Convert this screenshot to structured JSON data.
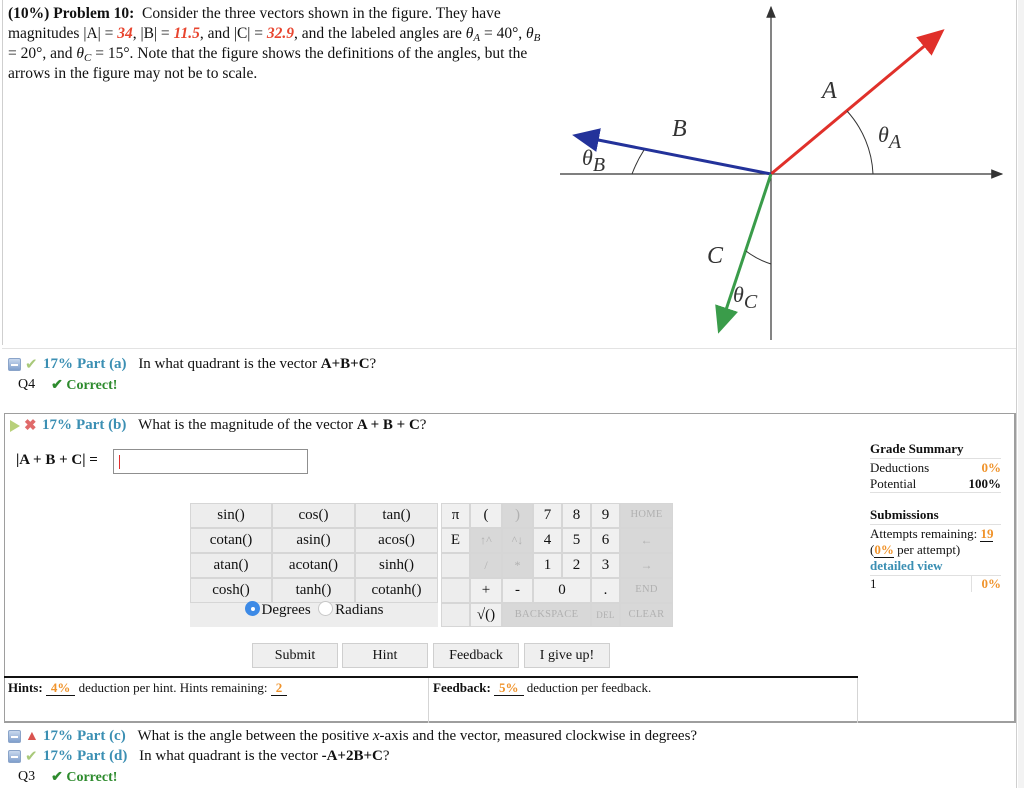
{
  "problem": {
    "weight": "(10%)",
    "title": "Problem 10:",
    "text_1": "Consider the three vectors shown in the figure. They have magnitudes ",
    "A_label": "|A| = ",
    "A_value": "34",
    "B_label": "|B| = ",
    "B_value": "11.5",
    "and": ", and ",
    "C_label": "|C| = ",
    "C_value": "32.9",
    "text_2": ", and the labeled angles are ",
    "theta_A": "40°",
    "theta_B": "20°",
    "theta_C": "15°",
    "text_3": ". Note that the figure shows the definitions of the angles, but the arrows in the figure may not be to scale."
  },
  "figure": {
    "labels": {
      "A": "A",
      "B": "B",
      "C": "C",
      "thetaA": "θA",
      "thetaB": "θB",
      "thetaC": "θC"
    },
    "colors": {
      "A": "#e0302a",
      "B": "#23329a",
      "C": "#3a9c4a",
      "axes": "#333333"
    }
  },
  "parts": [
    {
      "id": "a",
      "weight": "17%",
      "label": "Part (a)",
      "question_pre": "In what quadrant is the vector ",
      "question_bold": "A+B+C",
      "question_post": "?",
      "answer": "Q4",
      "status": "✔ Correct!",
      "icon": "check"
    },
    {
      "id": "b",
      "weight": "17%",
      "label": "Part (b)",
      "question_pre": "What is the magnitude of the vector ",
      "question_bold": "A + B + C",
      "question_post": "?",
      "icon": "x"
    },
    {
      "id": "c",
      "weight": "17%",
      "label": "Part (c)",
      "question_pre": "What is the angle between the positive ",
      "question_ital": "x",
      "question_post": "-axis and the vector, measured clockwise in degrees?",
      "icon": "warning"
    },
    {
      "id": "d",
      "weight": "17%",
      "label": "Part (d)",
      "question_pre": "In what quadrant is the vector ",
      "question_bold": "-A+2B+C",
      "question_post": "?",
      "answer": "Q3",
      "status": "✔ Correct!",
      "icon": "check"
    }
  ],
  "answer_field": {
    "label": "|A + B + C| = ",
    "value": ""
  },
  "function_keys": [
    "sin()",
    "cos()",
    "tan()",
    "cotan()",
    "asin()",
    "acos()",
    "atan()",
    "acotan()",
    "sinh()",
    "cosh()",
    "tanh()",
    "cotanh()"
  ],
  "angle_mode": {
    "options": [
      "Degrees",
      "Radians"
    ],
    "selected": "Degrees"
  },
  "keypad": {
    "pi": "π",
    "e": "E",
    "open": "(",
    "close": ")",
    "up": "↑^",
    "down": "^↓",
    "div": "/",
    "mul": "*",
    "plus": "+",
    "minus": "-",
    "sqrt": "√()",
    "d7": "7",
    "d8": "8",
    "d9": "9",
    "d4": "4",
    "d5": "5",
    "d6": "6",
    "d1": "1",
    "d2": "2",
    "d3": "3",
    "d0": "0",
    "dot": ".",
    "home": "HOME",
    "left": "←",
    "right": "→",
    "end": "END",
    "backspace": "BACKSPACE",
    "del": "DEL",
    "clear": "CLEAR"
  },
  "buttons": {
    "submit": "Submit",
    "hint": "Hint",
    "feedback": "Feedback",
    "giveup": "I give up!"
  },
  "hints": {
    "label": "Hints:",
    "deduction": "4%",
    "text": " deduction per hint. Hints remaining: ",
    "remaining": "2"
  },
  "feedback": {
    "label": "Feedback:",
    "deduction": "5%",
    "text": " deduction per feedback."
  },
  "grade_summary": {
    "title": "Grade Summary",
    "deductions_label": "Deductions",
    "deductions": "0%",
    "potential_label": "Potential",
    "potential": "100%",
    "submissions_title": "Submissions",
    "attempts_label": "Attempts remaining: ",
    "attempts": "19",
    "per_attempt": "0%",
    "per_attempt_text": " per attempt)",
    "detailed_view": "detailed view",
    "submission_rows": [
      {
        "n": "1",
        "pct": "0%"
      }
    ]
  }
}
